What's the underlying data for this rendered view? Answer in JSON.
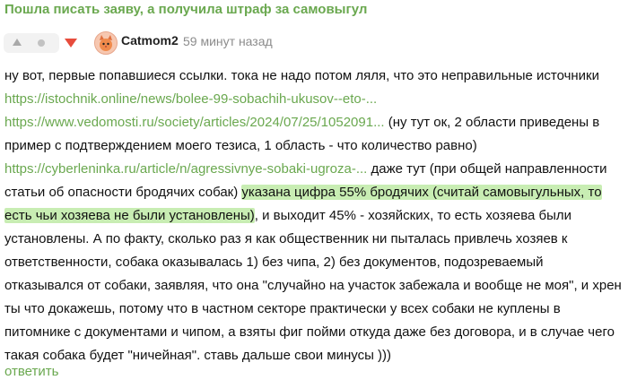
{
  "post": {
    "title": "Пошла писать заяву, а получила штраф за самовыгул"
  },
  "comment": {
    "author": "Catmom2",
    "time": "59 минут назад",
    "line1": "ну вот, первые попавшиеся ссылки. тока не надо потом ляля, что это неправильные источники",
    "link1": "https://istochnik.online/news/bolee-99-sobachih-ukusov--eto-...",
    "link2": "https://www.vedomosti.ru/society/articles/2024/07/25/1052091...",
    "line3_after": " (ну тут ок, 2 области приведены в",
    "line4": "пример с подтверждением моего тезиса, 1 область - что количество равно)",
    "link3": "https://cyberleninka.ru/article/n/agressivnye-sobaki-ugroza-...",
    "line5_after": " даже тут (при общей направленности",
    "line6_before": "статьи об опасности бродячих собак) ",
    "highlight1": "указана цифра 55% бродячих (считай самовыгульных, то",
    "highlight2": "есть чьи хозяева не были установлены)",
    "line7_after": ", и выходит 45% - хозяйских, то есть хозяева были",
    "line8": "установлены. А по факту, сколько раз я как общественник ни пыталась привлечь хозяев к",
    "line9": "ответственности, собака оказывалась 1) без чипа, 2) без документов, подозреваемый",
    "line10": "отказывался от собаки, заявляя, что она \"случайно на участок забежала и вообще не моя\", и хрен",
    "line11": "ты что докажешь, потому что в частном секторе практически у всех собаки не куплены в",
    "line12": "питомнике с документами и чипом, а взяты фиг пойми откуда даже без договора, и в случае чего",
    "line13": "такая собака будет \"ничейная\". ставь дальше свои минусы )))"
  },
  "actions": {
    "reply_label": "ответить"
  },
  "icons": {
    "upvote": "arrow-up-icon",
    "rating": "dot-icon",
    "downvote": "arrow-down-icon",
    "avatar": "cat-avatar"
  },
  "colors": {
    "link": "#6aa84f",
    "highlight": "#c8edb3",
    "downvote": "#e74c3c"
  }
}
